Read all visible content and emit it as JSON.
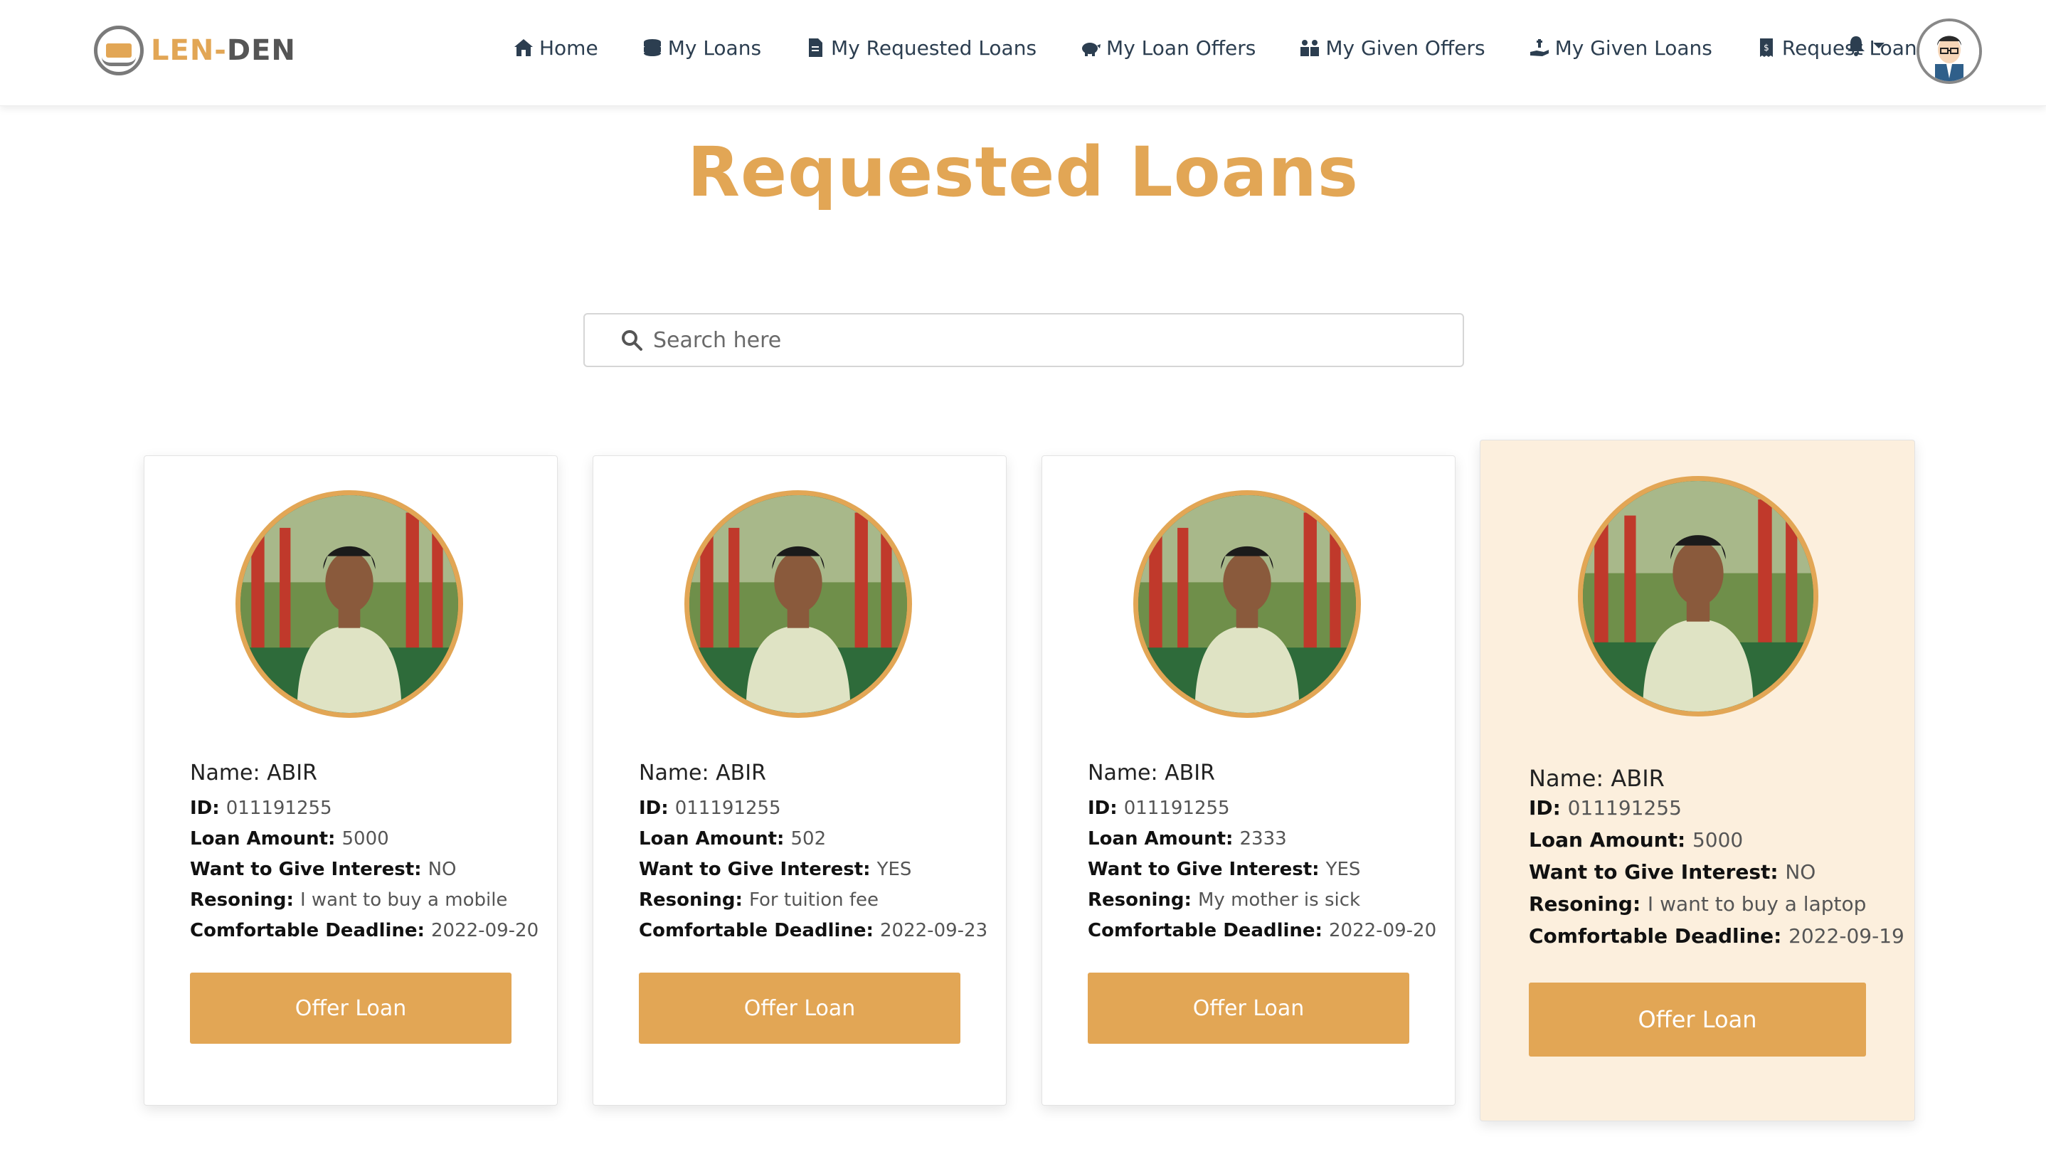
{
  "brand": {
    "part1": "LEN-",
    "part2": "DEN"
  },
  "nav": [
    {
      "label": "Home",
      "icon": "house-icon"
    },
    {
      "label": "My Loans",
      "icon": "coins-icon"
    },
    {
      "label": "My Requested Loans",
      "icon": "document-icon"
    },
    {
      "label": "My Loan Offers",
      "icon": "piggy-bank-icon"
    },
    {
      "label": "My Given Offers",
      "icon": "people-icon"
    },
    {
      "label": "My Given Loans",
      "icon": "hand-holding-money-icon"
    },
    {
      "label": "Request Loan",
      "icon": "receipt-icon"
    }
  ],
  "page": {
    "title": "Requested Loans"
  },
  "search": {
    "placeholder": "Search here"
  },
  "card_labels": {
    "name": "Name:",
    "id": "ID:",
    "amount": "Loan Amount:",
    "interest": "Want to Give Interest:",
    "reason": "Resoning:",
    "deadline": "Comfortable Deadline:",
    "button": "Offer Loan"
  },
  "cards": [
    {
      "name": "ABIR",
      "id": "011191255",
      "amount": "5000",
      "interest": "NO",
      "reason": "I want to buy a mobile",
      "deadline": "2022-09-20"
    },
    {
      "name": "ABIR",
      "id": "011191255",
      "amount": "502",
      "interest": "YES",
      "reason": "For tuition fee",
      "deadline": "2022-09-23"
    },
    {
      "name": "ABIR",
      "id": "011191255",
      "amount": "2333",
      "interest": "YES",
      "reason": "My mother is sick",
      "deadline": "2022-09-20"
    },
    {
      "name": "ABIR",
      "id": "011191255",
      "amount": "5000",
      "interest": "NO",
      "reason": "I want to buy a laptop",
      "deadline": "2022-09-19"
    }
  ],
  "colors": {
    "accent": "#e2a655",
    "nav_text": "#2c3e50",
    "highlight_card": "#fcefdd"
  }
}
